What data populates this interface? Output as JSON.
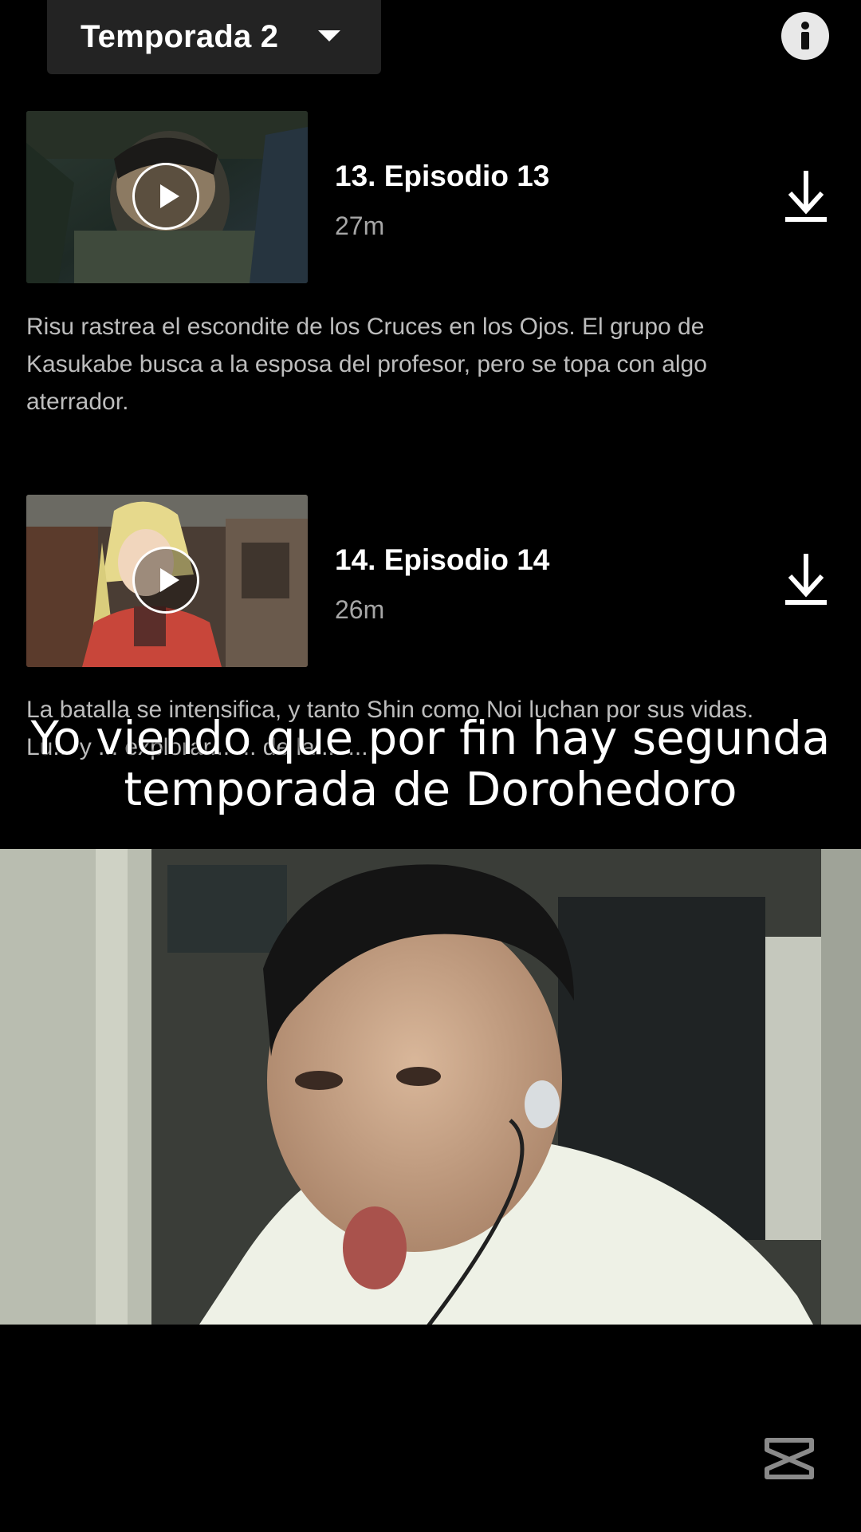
{
  "season_selector": {
    "label": "Temporada 2"
  },
  "episodes": [
    {
      "title": "13. Episodio 13",
      "duration": "27m",
      "description": "Risu rastrea el escondite de los Cruces en los Ojos. El grupo de Kasukabe busca a la esposa del profesor, pero se topa con algo aterrador."
    },
    {
      "title": "14. Episodio 14",
      "duration": "26m",
      "description": "La batalla se intensifica, y tanto Shin como Noi luchan por sus vidas. Lu... y ... explorar... ... de la ... ..."
    }
  ],
  "caption": {
    "line1": "Yo viendo que por fin hay segunda",
    "line2": "temporada de Dorohedoro"
  },
  "icons": {
    "season_dropdown": "chevron-down-icon",
    "info": "info-icon",
    "play": "play-icon",
    "download": "download-icon",
    "watermark": "capcut-logo-icon"
  },
  "colors": {
    "background": "#000000",
    "selector_bg": "#232323",
    "title_text": "#ffffff",
    "secondary_text": "#a6a6a6",
    "description_text": "#bdbdbd"
  }
}
